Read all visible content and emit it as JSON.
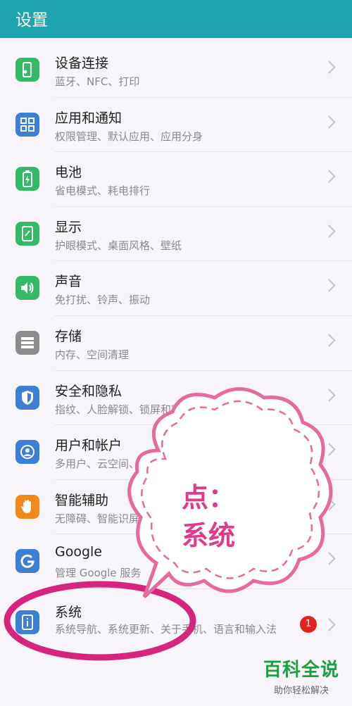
{
  "header": {
    "title": "设置"
  },
  "items": [
    {
      "label": "设备连接",
      "sub": "蓝牙、NFC、打印",
      "icon": "device-connection-icon"
    },
    {
      "label": "应用和通知",
      "sub": "权限管理、默认应用、应用分身",
      "icon": "apps-icon"
    },
    {
      "label": "电池",
      "sub": "省电模式、耗电排行",
      "icon": "battery-icon"
    },
    {
      "label": "显示",
      "sub": "护眼模式、桌面风格、壁纸",
      "icon": "display-icon"
    },
    {
      "label": "声音",
      "sub": "免打扰、铃声、振动",
      "icon": "sound-icon"
    },
    {
      "label": "存储",
      "sub": "内存、空间清理",
      "icon": "storage-icon"
    },
    {
      "label": "安全和隐私",
      "sub": "指纹、人脸解锁、锁屏和密码、学生模式",
      "icon": "shield-icon"
    },
    {
      "label": "用户和帐户",
      "sub": "多用户、云空间、帐户",
      "icon": "user-icon"
    },
    {
      "label": "智能辅助",
      "sub": "无障碍、智能识屏、手势控制",
      "icon": "hand-icon"
    },
    {
      "label": "Google",
      "sub": "管理 Google 服务",
      "icon": "google-icon"
    },
    {
      "label": "系统",
      "sub": "系统导航、系统更新、关于手机、语言和输入法",
      "icon": "system-info-icon",
      "badge": "1"
    }
  ],
  "annotation": {
    "line1": "点：",
    "line2": "系统"
  },
  "watermark": {
    "title": "百科全说",
    "subtitle": "助你轻松解决"
  },
  "colors": {
    "header": "#1fa3ae",
    "annotation": "#e03a8c",
    "badge": "#e52222"
  }
}
